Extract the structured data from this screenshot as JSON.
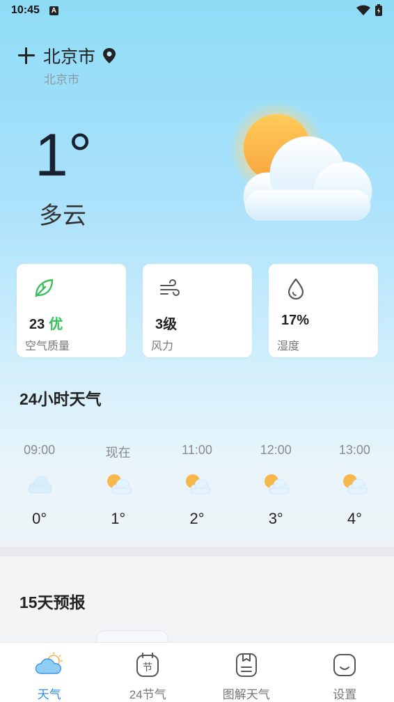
{
  "status_bar": {
    "time": "10:45",
    "notification_badge": "A"
  },
  "location": {
    "city": "北京市",
    "sub_city": "北京市"
  },
  "current": {
    "temperature": "1°",
    "condition": "多云"
  },
  "metrics": [
    {
      "value": "23",
      "quality": "优",
      "label": "空气质量",
      "icon": "leaf-icon"
    },
    {
      "value": "3级",
      "label": "风力",
      "icon": "wind-icon"
    },
    {
      "value": "17%",
      "label": "湿度",
      "icon": "water-drop-icon"
    }
  ],
  "hourly_section": {
    "title": "24小时天气",
    "hours": [
      {
        "time": "09:00",
        "temp": "0°",
        "icon": "cloudy-icon"
      },
      {
        "time": "现在",
        "temp": "1°",
        "icon": "partly-cloudy-icon"
      },
      {
        "time": "11:00",
        "temp": "2°",
        "icon": "partly-cloudy-icon"
      },
      {
        "time": "12:00",
        "temp": "3°",
        "icon": "partly-cloudy-icon"
      },
      {
        "time": "13:00",
        "temp": "4°",
        "icon": "partly-cloudy-icon"
      }
    ]
  },
  "forecast_section": {
    "title": "15天预报"
  },
  "tabs": [
    {
      "label": "天气",
      "active": true
    },
    {
      "label": "24节气",
      "active": false
    },
    {
      "label": "图解天气",
      "active": false
    },
    {
      "label": "设置",
      "active": false
    }
  ],
  "colors": {
    "accent": "#2f8ee8",
    "good": "#37c05b"
  }
}
